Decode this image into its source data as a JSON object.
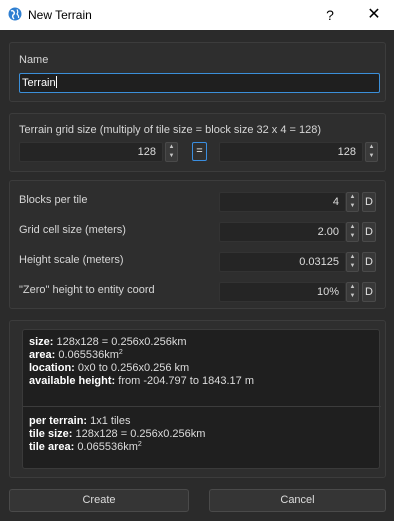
{
  "window": {
    "title": "New Terrain",
    "help_glyph": "?",
    "close_glyph": "✕"
  },
  "name_section": {
    "label": "Name",
    "value": "Terrain"
  },
  "grid_section": {
    "label": "Terrain grid size (multiply of tile size = block size 32 x 4 = 128)",
    "left_value": "128",
    "link_label": "=",
    "right_value": "128"
  },
  "params": [
    {
      "label": "Blocks per tile",
      "value": "4",
      "d": "D"
    },
    {
      "label": "Grid cell size (meters)",
      "value": "2.00",
      "d": "D"
    },
    {
      "label": "Height scale (meters)",
      "value": "0.03125",
      "d": "D"
    },
    {
      "label": "\"Zero\" height to entity coord",
      "value": "10%",
      "d": "D"
    }
  ],
  "info": {
    "size_key": "size:",
    "size_val": "128x128 = 0.256x0.256km",
    "area_key": "area:",
    "area_val": "0.065536km",
    "area_sup": "2",
    "location_key": "location:",
    "location_val": "0x0 to 0.256x0.256 km",
    "height_key": "available height:",
    "height_val": "from -204.797 to 1843.17 m",
    "per_terrain_key": "per terrain:",
    "per_terrain_val": "1x1 tiles",
    "tile_size_key": "tile size:",
    "tile_size_val": "128x128 = 0.256x0.256km",
    "tile_area_key": "tile area:",
    "tile_area_val": "0.065536km",
    "tile_area_sup": "2"
  },
  "buttons": {
    "create": "Create",
    "cancel": "Cancel"
  },
  "icons": {
    "app": "globe-icon",
    "spin_up": "▲",
    "spin_down": "▼"
  },
  "colors": {
    "accent": "#3b8fd9",
    "background": "#2b2b2b"
  }
}
